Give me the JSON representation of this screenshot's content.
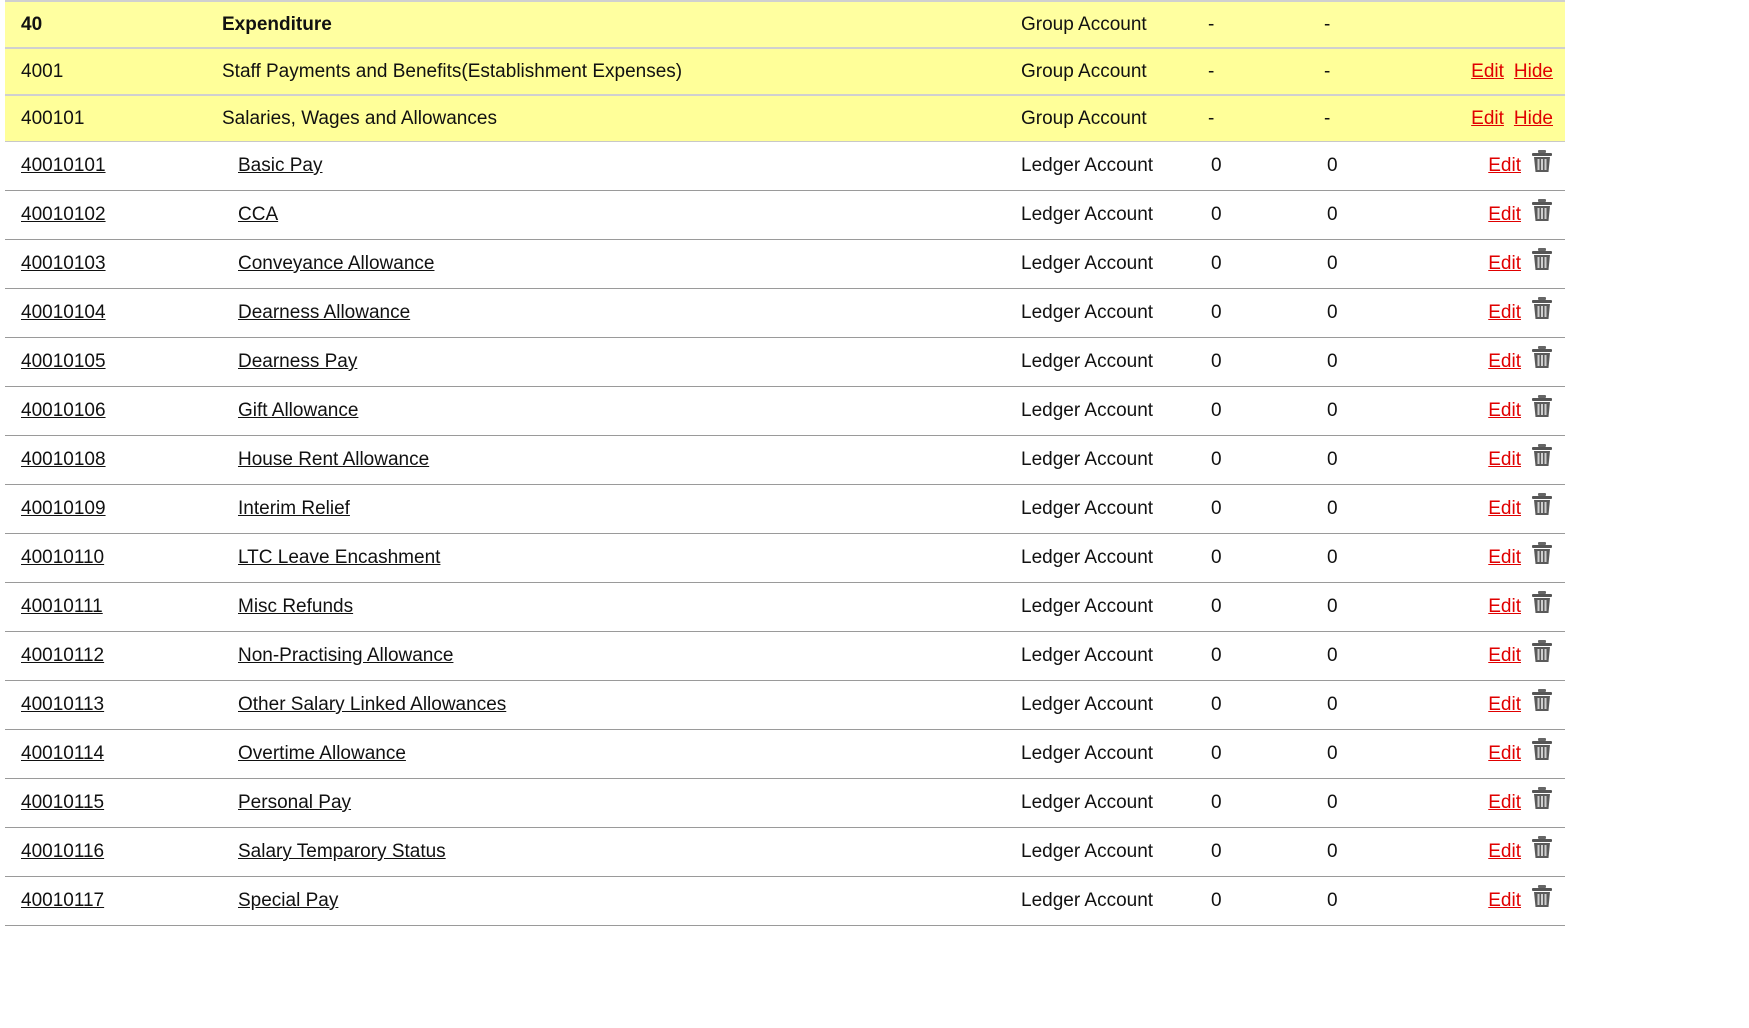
{
  "colors": {
    "group_row_bg": "#ffff99",
    "link_red": "#e00000",
    "text": "#111111"
  },
  "group_rows": [
    {
      "code": "40",
      "name": "Expenditure",
      "type": "Group Account",
      "debit": "-",
      "credit": "-",
      "bold": true,
      "actions": []
    },
    {
      "code": "4001",
      "name": "Staff Payments and Benefits(Establishment Expenses)",
      "type": "Group Account",
      "debit": "-",
      "credit": "-",
      "bold": false,
      "actions": [
        "Edit",
        "Hide"
      ]
    },
    {
      "code": "400101",
      "name": "Salaries, Wages and Allowances",
      "type": "Group Account",
      "debit": "-",
      "credit": "-",
      "bold": false,
      "actions": [
        "Edit",
        "Hide"
      ]
    }
  ],
  "ledger_rows": [
    {
      "code": "40010101",
      "name": "Basic Pay",
      "type": "Ledger Account",
      "debit": "0",
      "credit": "0",
      "edit": "Edit",
      "icon": "trash-icon"
    },
    {
      "code": "40010102",
      "name": "CCA",
      "type": "Ledger Account",
      "debit": "0",
      "credit": "0",
      "edit": "Edit",
      "icon": "trash-icon"
    },
    {
      "code": "40010103",
      "name": "Conveyance Allowance",
      "type": "Ledger Account",
      "debit": "0",
      "credit": "0",
      "edit": "Edit",
      "icon": "trash-icon"
    },
    {
      "code": "40010104",
      "name": "Dearness Allowance",
      "type": "Ledger Account",
      "debit": "0",
      "credit": "0",
      "edit": "Edit",
      "icon": "trash-icon"
    },
    {
      "code": "40010105",
      "name": "Dearness Pay",
      "type": "Ledger Account",
      "debit": "0",
      "credit": "0",
      "edit": "Edit",
      "icon": "trash-icon"
    },
    {
      "code": "40010106",
      "name": "Gift Allowance",
      "type": "Ledger Account",
      "debit": "0",
      "credit": "0",
      "edit": "Edit",
      "icon": "trash-icon"
    },
    {
      "code": "40010108",
      "name": "House Rent Allowance",
      "type": "Ledger Account",
      "debit": "0",
      "credit": "0",
      "edit": "Edit",
      "icon": "trash-icon"
    },
    {
      "code": "40010109",
      "name": "Interim Relief",
      "type": "Ledger Account",
      "debit": "0",
      "credit": "0",
      "edit": "Edit",
      "icon": "trash-icon"
    },
    {
      "code": "40010110",
      "name": "LTC Leave Encashment",
      "type": "Ledger Account",
      "debit": "0",
      "credit": "0",
      "edit": "Edit",
      "icon": "trash-icon"
    },
    {
      "code": "40010111",
      "name": "Misc Refunds",
      "type": "Ledger Account",
      "debit": "0",
      "credit": "0",
      "edit": "Edit",
      "icon": "trash-icon"
    },
    {
      "code": "40010112",
      "name": "Non-Practising Allowance",
      "type": "Ledger Account",
      "debit": "0",
      "credit": "0",
      "edit": "Edit",
      "icon": "trash-icon"
    },
    {
      "code": "40010113",
      "name": "Other Salary Linked Allowances",
      "type": "Ledger Account",
      "debit": "0",
      "credit": "0",
      "edit": "Edit",
      "icon": "trash-icon"
    },
    {
      "code": "40010114",
      "name": "Overtime Allowance",
      "type": "Ledger Account",
      "debit": "0",
      "credit": "0",
      "edit": "Edit",
      "icon": "trash-icon"
    },
    {
      "code": "40010115",
      "name": "Personal Pay",
      "type": "Ledger Account",
      "debit": "0",
      "credit": "0",
      "edit": "Edit",
      "icon": "trash-icon"
    },
    {
      "code": "40010116",
      "name": "Salary Temparory Status",
      "type": "Ledger Account",
      "debit": "0",
      "credit": "0",
      "edit": "Edit",
      "icon": "trash-icon"
    },
    {
      "code": "40010117",
      "name": "Special Pay",
      "type": "Ledger Account",
      "debit": "0",
      "credit": "0",
      "edit": "Edit",
      "icon": "trash-icon"
    }
  ]
}
